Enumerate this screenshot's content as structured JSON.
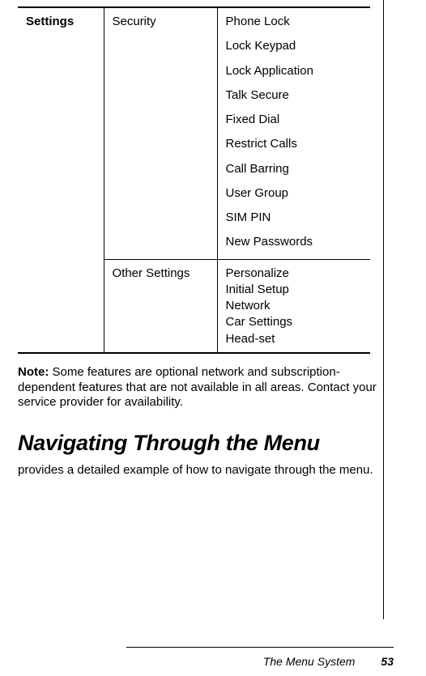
{
  "table": {
    "col1": "Settings",
    "security": {
      "label": "Security",
      "items": [
        "Phone Lock",
        "Lock Keypad",
        "Lock Application",
        "Talk Secure",
        "Fixed Dial",
        "Restrict Calls",
        "Call Barring",
        "User Group",
        "SIM PIN",
        "New Passwords"
      ]
    },
    "other": {
      "label": "Other Settings",
      "items": [
        "Personalize",
        "Initial Setup",
        "Network",
        "Car Settings",
        "Head-set"
      ]
    }
  },
  "note_label": "Note: ",
  "note_body": "Some features are optional network and subscription-dependent features that are not available in all areas. Contact your service provider for availability.",
  "heading": "Navigating Through the Menu",
  "para": "provides a detailed example of how to navigate through the menu.",
  "footer_title": "The Menu System",
  "page_number": "53"
}
